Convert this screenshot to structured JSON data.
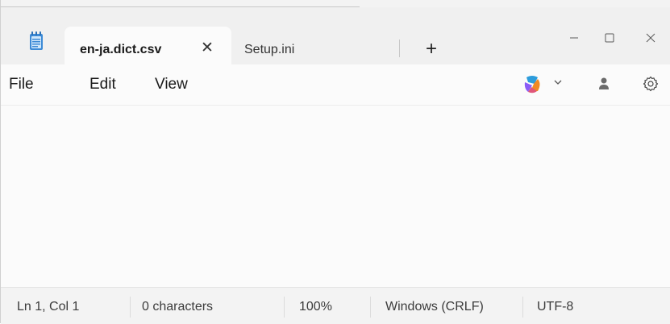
{
  "tabs": [
    {
      "title": "en-ja.dict.csv",
      "close_glyph": "✕",
      "active": true
    },
    {
      "title": "Setup.ini",
      "active": false
    }
  ],
  "new_tab_glyph": "+",
  "menu": {
    "file": "File",
    "edit": "Edit",
    "view": "View"
  },
  "status": {
    "position": "Ln 1, Col 1",
    "characters": "0 characters",
    "zoom": "100%",
    "line_ending": "Windows (CRLF)",
    "encoding": "UTF-8"
  },
  "icons": {
    "app": "notepad-icon",
    "copilot": "copilot-icon",
    "account": "account-icon",
    "settings": "gear-icon"
  },
  "colors": {
    "app_icon": "#3c8ad6",
    "copilot_orange": "#f08a24",
    "copilot_purple": "#8b5cf6",
    "copilot_blue": "#2d9cdb"
  }
}
